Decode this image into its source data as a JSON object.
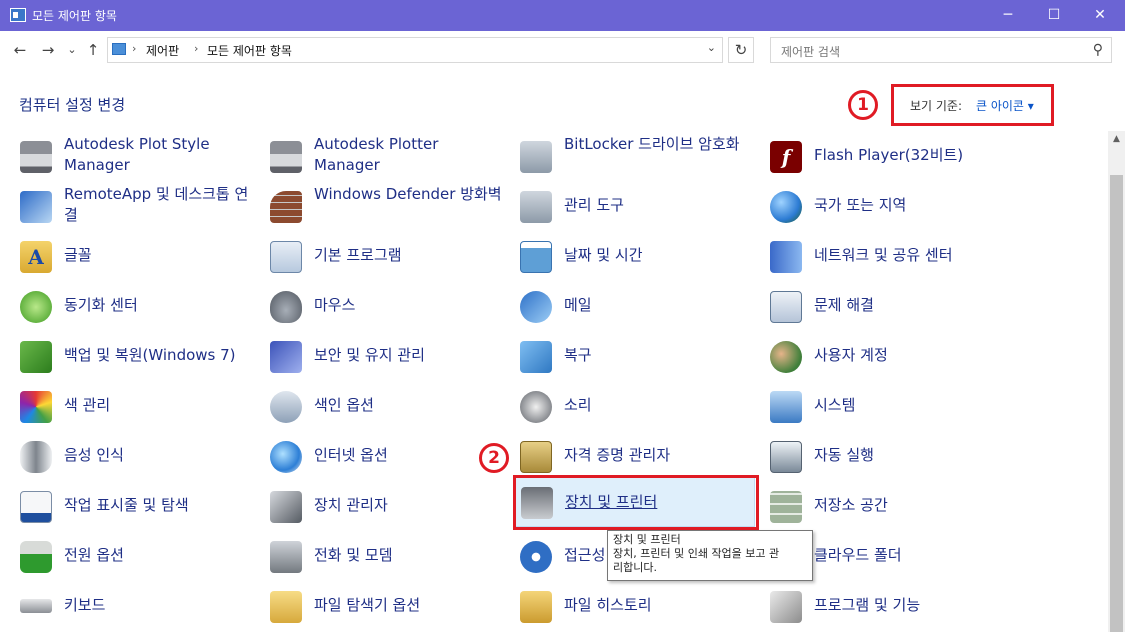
{
  "window": {
    "title": "모든 제어판 항목",
    "titlebar_color": "#6b64d4",
    "min_glyph": "─",
    "max_glyph": "☐",
    "close_glyph": "✕"
  },
  "nav": {
    "back_glyph": "←",
    "forward_glyph": "→",
    "recent_glyph": "⌄",
    "up_glyph": "↑",
    "breadcrumb": [
      "제어판",
      "모든 제어판 항목"
    ],
    "separator": "›",
    "dropdown_glyph": "⌄",
    "refresh_glyph": "↻",
    "search_placeholder": "제어판 검색",
    "search_glyph": "⚲"
  },
  "header": {
    "title": "컴퓨터 설정 변경",
    "view_by_label": "보기 기준:",
    "view_by_value": "큰 아이콘 ▾",
    "annotation_1": "1",
    "annotation_2": "2",
    "annotation_color": "#e01b24"
  },
  "items": [
    {
      "label": "Autodesk Plot Style Manager",
      "icon": "printer-icon"
    },
    {
      "label": "Autodesk Plotter Manager",
      "icon": "printer-icon"
    },
    {
      "label": "BitLocker 드라이브 암호화",
      "icon": "bitlocker-key-icon"
    },
    {
      "label": "Flash Player(32비트)",
      "icon": "flash-icon"
    },
    {
      "label": "RemoteApp 및 데스크톱 연결",
      "icon": "remote-desktop-icon"
    },
    {
      "label": "Windows Defender 방화벽",
      "icon": "firewall-icon"
    },
    {
      "label": "관리 도구",
      "icon": "admin-tools-icon"
    },
    {
      "label": "국가 또는 지역",
      "icon": "region-globe-icon"
    },
    {
      "label": "글꼴",
      "icon": "fonts-folder-icon"
    },
    {
      "label": "기본 프로그램",
      "icon": "default-programs-icon"
    },
    {
      "label": "날짜 및 시간",
      "icon": "date-time-icon"
    },
    {
      "label": "네트워크 및 공유 센터",
      "icon": "network-icon"
    },
    {
      "label": "동기화 센터",
      "icon": "sync-icon"
    },
    {
      "label": "마우스",
      "icon": "mouse-icon"
    },
    {
      "label": "메일",
      "icon": "mail-icon"
    },
    {
      "label": "문제 해결",
      "icon": "troubleshoot-icon"
    },
    {
      "label": "백업 및 복원(Windows 7)",
      "icon": "backup-icon"
    },
    {
      "label": "보안 및 유지 관리",
      "icon": "security-flag-icon"
    },
    {
      "label": "복구",
      "icon": "recovery-icon"
    },
    {
      "label": "사용자 계정",
      "icon": "user-accounts-icon"
    },
    {
      "label": "색 관리",
      "icon": "color-management-icon"
    },
    {
      "label": "색인 옵션",
      "icon": "indexing-icon"
    },
    {
      "label": "소리",
      "icon": "speaker-icon"
    },
    {
      "label": "시스템",
      "icon": "system-monitor-icon"
    },
    {
      "label": "음성 인식",
      "icon": "microphone-icon"
    },
    {
      "label": "인터넷 옵션",
      "icon": "internet-options-icon"
    },
    {
      "label": "자격 증명 관리자",
      "icon": "credential-vault-icon"
    },
    {
      "label": "자동 실행",
      "icon": "autoplay-icon"
    },
    {
      "label": "작업 표시줄 및 탐색",
      "icon": "taskbar-icon"
    },
    {
      "label": "장치 관리자",
      "icon": "device-manager-icon"
    },
    {
      "label": "장치 및 프린터",
      "icon": "devices-printers-icon"
    },
    {
      "label": "저장소 공간",
      "icon": "storage-spaces-icon"
    },
    {
      "label": "전원 옵션",
      "icon": "power-battery-icon"
    },
    {
      "label": "전화 및 모뎀",
      "icon": "phone-modem-icon"
    },
    {
      "label": "접근성",
      "icon": "ease-of-access-icon"
    },
    {
      "label": "클라우드 폴더",
      "icon": "cloud-folder-icon"
    },
    {
      "label": "키보드",
      "icon": "keyboard-icon"
    },
    {
      "label": "파일 탐색기 옵션",
      "icon": "folder-options-icon"
    },
    {
      "label": "파일 히스토리",
      "icon": "file-history-icon"
    },
    {
      "label": "프로그램 및 기능",
      "icon": "programs-features-icon"
    }
  ],
  "tooltip": {
    "title": "장치 및 프린터",
    "line1": "장치, 프린터 및 인쇄 작업을 보고 관",
    "line2": "리합니다."
  },
  "scrollbar": {
    "up_glyph": "▲"
  }
}
